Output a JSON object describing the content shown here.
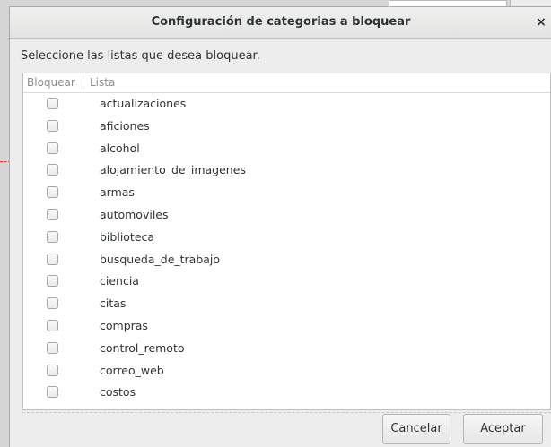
{
  "dialog": {
    "title": "Configuración de categorias a bloquear",
    "close_glyph": "×",
    "prompt": "Seleccione las listas que desea bloquear.",
    "columns": {
      "block": "Bloquear",
      "list": "Lista"
    },
    "items": [
      {
        "label": "actualizaciones",
        "checked": false
      },
      {
        "label": "aficiones",
        "checked": false
      },
      {
        "label": "alcohol",
        "checked": false
      },
      {
        "label": "alojamiento_de_imagenes",
        "checked": false
      },
      {
        "label": "armas",
        "checked": false
      },
      {
        "label": "automoviles",
        "checked": false
      },
      {
        "label": "biblioteca",
        "checked": false
      },
      {
        "label": "busqueda_de_trabajo",
        "checked": false
      },
      {
        "label": "ciencia",
        "checked": false
      },
      {
        "label": "citas",
        "checked": false
      },
      {
        "label": "compras",
        "checked": false
      },
      {
        "label": "control_remoto",
        "checked": false
      },
      {
        "label": "correo_web",
        "checked": false
      },
      {
        "label": "costos",
        "checked": false
      }
    ],
    "buttons": {
      "cancel": "Cancelar",
      "accept": "Aceptar"
    }
  }
}
